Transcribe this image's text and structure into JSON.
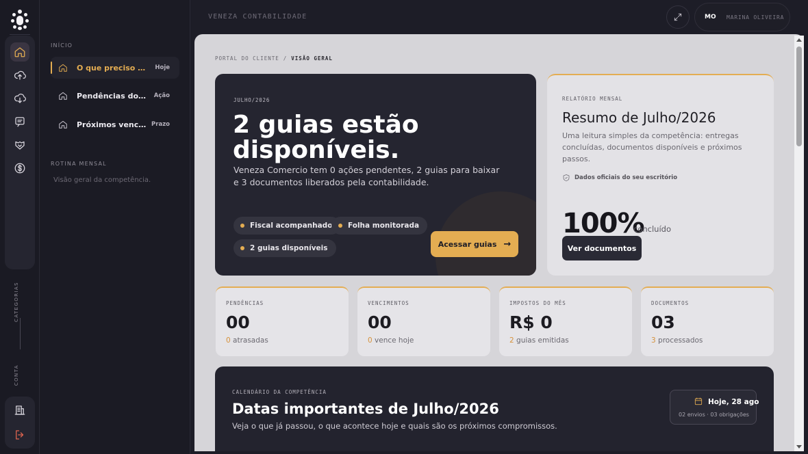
{
  "app": {
    "company": "VENEZA CONTABILIDADE"
  },
  "user": {
    "initials": "MO",
    "name": "MARINA OLIVEIRA"
  },
  "rail": {
    "labels": {
      "categorias": "CATEGORIAS",
      "conta": "CONTA"
    },
    "icons": [
      "home-icon",
      "upload-cloud-icon",
      "download-cloud-icon",
      "message-icon",
      "handshake-icon",
      "dollar-icon",
      "building-icon",
      "logout-icon"
    ]
  },
  "nav": {
    "section_inicio": "INÍCIO",
    "items": [
      {
        "label": "O que preciso fazer",
        "tag": "Hoje"
      },
      {
        "label": "Pendências do mês",
        "tag": "Ação"
      },
      {
        "label": "Próximos vencimentos",
        "tag": "Prazo"
      }
    ],
    "section_rotina": "ROTINA MENSAL",
    "rotina_desc": "Visão geral da competência."
  },
  "breadcrumb": {
    "root": "PORTAL DO CLIENTE",
    "separator": "/",
    "current": "VISÃO GERAL"
  },
  "hero": {
    "kicker": "JULHO/2026",
    "title": "2 guias estão disponíveis.",
    "desc": "Veneza Comercio tem 0 ações pendentes, 2 guias para baixar e 3 documentos liberados pela contabilidade.",
    "chips": [
      "Fiscal acompanhado",
      "Folha monitorada",
      "2 guias disponíveis"
    ],
    "button": "Acessar guias",
    "accent": "#e4ad52"
  },
  "report": {
    "kicker": "RELATÓRIO MENSAL",
    "title": "Resumo de Julho/2026",
    "desc": "Uma leitura simples da competência: entregas concluídas, documentos disponíveis e próximos passos.",
    "note": "Dados oficiais do seu escritório",
    "percent": "100%",
    "percent_label": "concluído",
    "button": "Ver documentos"
  },
  "stats": [
    {
      "label": "PENDÊNCIAS",
      "value": "00",
      "num": "0",
      "sub": "atrasadas"
    },
    {
      "label": "VENCIMENTOS",
      "value": "00",
      "num": "0",
      "sub": "vence hoje"
    },
    {
      "label": "IMPOSTOS DO MÊS",
      "value": "R$ 0",
      "num": "2",
      "sub": "guias emitidas"
    },
    {
      "label": "DOCUMENTOS",
      "value": "03",
      "num": "3",
      "sub": "processados"
    }
  ],
  "calendar": {
    "kicker": "CALENDÁRIO DA COMPETÊNCIA",
    "title": "Datas importantes de Julho/2026",
    "desc": "Veja o que já passou, o que acontece hoje e quais são os próximos compromissos.",
    "today": "Hoje, 28 ago",
    "today_sub": "02 envios · 03 obrigações"
  }
}
